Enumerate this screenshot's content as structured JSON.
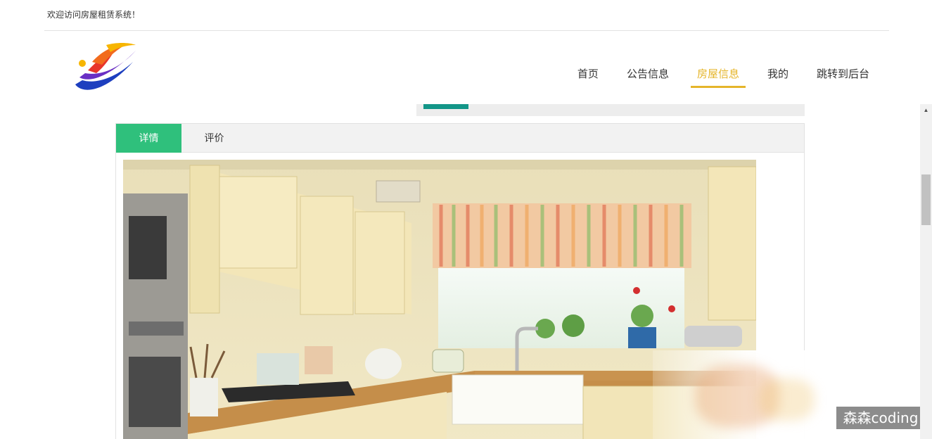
{
  "top": {
    "welcome": "欢迎访问房屋租赁系统！"
  },
  "nav": {
    "items": [
      {
        "label": "首页"
      },
      {
        "label": "公告信息"
      },
      {
        "label": "房屋信息",
        "active": true
      },
      {
        "label": "我的"
      },
      {
        "label": "跳转到后台"
      }
    ]
  },
  "tabs": [
    {
      "label": "详情",
      "active": true
    },
    {
      "label": "评价"
    }
  ],
  "watermark": "森森coding",
  "colors": {
    "accent": "#e5b52a",
    "tab_active": "#2fc07c",
    "gallery_bar": "#139688"
  },
  "icons": {
    "logo": "logo-emblem",
    "scroll_up": "arrow-up-icon"
  }
}
